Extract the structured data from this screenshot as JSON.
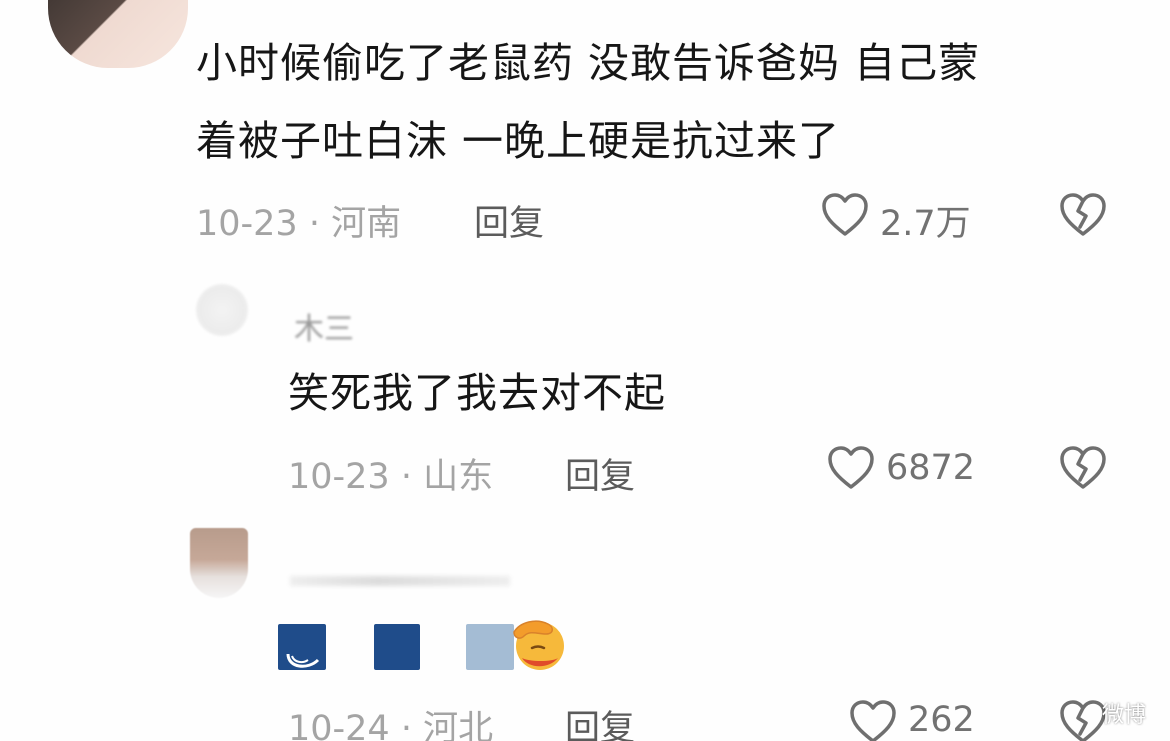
{
  "comments": [
    {
      "text_line1": "小时候偷吃了老鼠药  没敢告诉爸妈 自己蒙",
      "text_line2": "着被子吐白沫 一晚上硬是抗过来了",
      "date": "10-23",
      "separator": "·",
      "location": "河南",
      "reply_label": "回复",
      "likes": "2.7万"
    },
    {
      "username": "木三",
      "text": "笑死我了我去对不起",
      "date": "10-23",
      "separator": "·",
      "location": "山东",
      "reply_label": "回复",
      "likes": "6872"
    },
    {
      "date": "10-24",
      "separator": "·",
      "location": "河北",
      "reply_label": "回复",
      "likes": "262"
    }
  ],
  "watermark": "微博",
  "icons": {
    "like": "heart-outline-icon",
    "dislike": "broken-heart-icon",
    "reaction": "face-palm-emoji"
  },
  "colors": {
    "text": "#161616",
    "meta": "#a4a4a4",
    "reply": "#5b5b5b",
    "count": "#727272",
    "emoji_blue": "#1f4c8a"
  }
}
